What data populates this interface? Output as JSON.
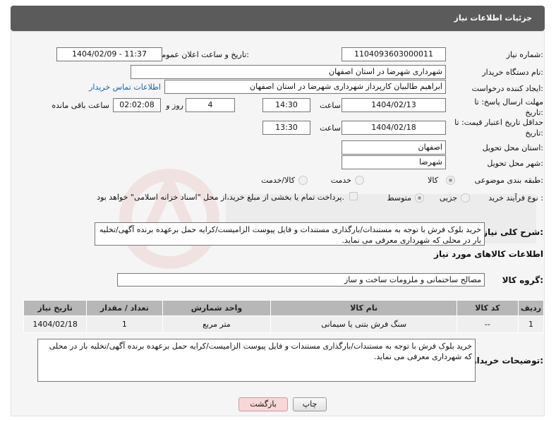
{
  "title": "جزئیات اطلاعات نیاز",
  "fields": {
    "need_number_label": "شماره نیاز:",
    "need_number": "1104093603000011",
    "announce_label": "تاریخ و ساعت اعلان عمومی:",
    "announce_value": "1404/02/09 - 11:37",
    "buyer_org_label": "نام دستگاه خریدار:",
    "buyer_org": "شهرداری شهرضا در استان اصفهان",
    "creator_label": "ایجاد کننده درخواست:",
    "creator": "ابراهیم طالبیان کارپرداز شهرداری شهرضا در استان اصفهان",
    "contact_link": "اطلاعات تماس خریدار",
    "deadline_label": "مهلت ارسال پاسخ: تا تاریخ:",
    "deadline_date": "1404/02/13",
    "time_label": "ساعت",
    "deadline_time": "14:30",
    "days": "4",
    "days_label": "روز و",
    "remaining": "02:02:08",
    "remaining_label": "ساعت باقی مانده",
    "price_valid_label": "حداقل تاریخ اعتبار قیمت: تا تاریخ:",
    "price_valid_date": "1404/02/18",
    "price_valid_time": "13:30",
    "province_label": "استان محل تحویل:",
    "province": "اصفهان",
    "city_label": "شهر محل تحویل:",
    "city": "شهرضا",
    "category_label": "طبقه بندی موضوعی:",
    "cat_goods": "کالا",
    "cat_service": "خدمت",
    "cat_goods_service": "کالا/خدمت",
    "purchase_type_label": "نوع فرآیند خرید :",
    "pt_partial": "جزیی",
    "pt_medium": "متوسط",
    "payment_note": "پرداخت تمام یا بخشی از مبلغ خرید،از محل \"اسناد خزانه اسلامی\" خواهد بود.",
    "description_label": "شرح کلی نیاز:",
    "description": "خرید بلوک فرش با توجه به مستندات/بارگذاری مستندات و فایل پیوست الزامیست/کرایه حمل برعهده برنده آگهی/تخلیه بار در محلی که شهرداری معرفی می نماید."
  },
  "goods_section": {
    "heading": "اطلاعات کالاهای مورد نیاز",
    "group_label": "گروه کالا:",
    "group_value": "مصالح ساختمانی و ملزومات ساخت و ساز"
  },
  "table": {
    "headers": [
      "ردیف",
      "کد کالا",
      "نام کالا",
      "واحد شمارش",
      "تعداد / مقدار",
      "تاریخ نیاز"
    ],
    "rows": [
      [
        "1",
        "--",
        "سنگ فرش بتنی یا سیمانی",
        "متر مربع",
        "1",
        "1404/02/18"
      ]
    ]
  },
  "buyer_notes_label": "توضیحات خریدار:",
  "buyer_notes": "خرید بلوک فرش با توجه به مستندات/بارگذاری مستندات و فایل پیوست الزامیست/کرایه حمل برعهده برنده آگهی/تخلیه بار در محلی که شهرداری معرفی می نماید.",
  "buttons": {
    "print": "چاپ",
    "back": "بازگشت"
  },
  "colors": {
    "titlebar": "#5b5b5b",
    "panel": "#f5f5f5",
    "table_header": "#b7b7b7",
    "link": "#1a5fb4",
    "back_button": "#f8d7d7"
  }
}
